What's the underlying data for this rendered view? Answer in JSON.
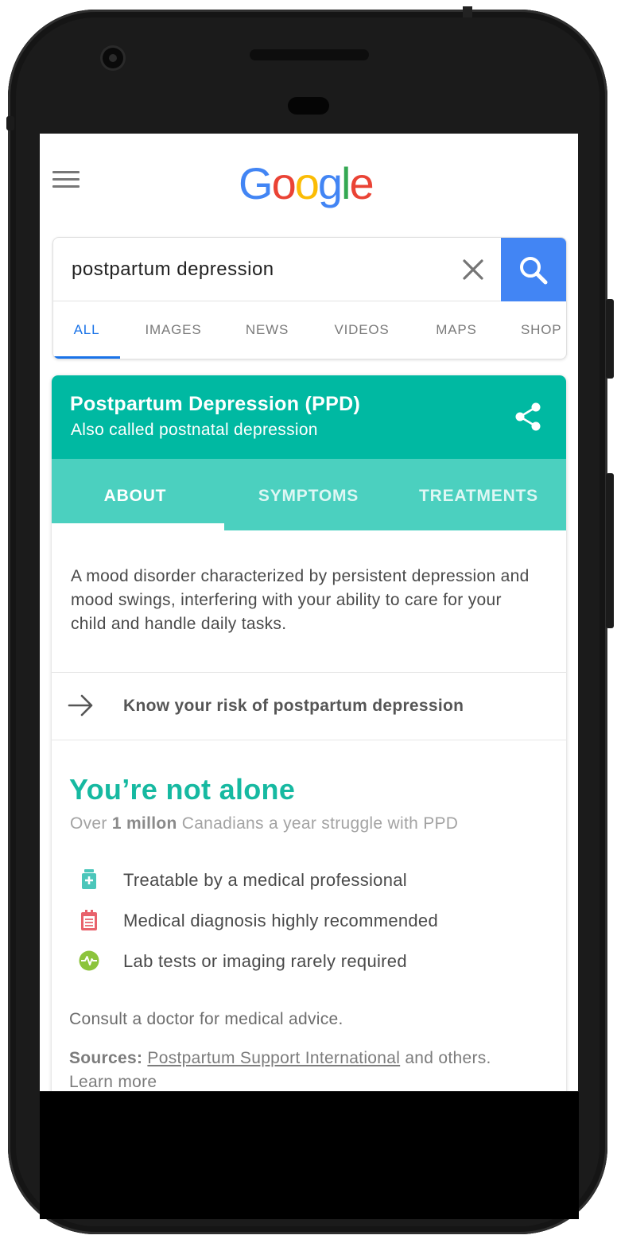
{
  "app": {
    "logo_text": "Google"
  },
  "search": {
    "query": "postpartum depression",
    "clear_icon": "close-icon",
    "search_icon": "search-icon"
  },
  "search_tabs": [
    {
      "label": "ALL",
      "active": true
    },
    {
      "label": "IMAGES",
      "active": false
    },
    {
      "label": "NEWS",
      "active": false
    },
    {
      "label": "VIDEOS",
      "active": false
    },
    {
      "label": "MAPS",
      "active": false
    },
    {
      "label": "SHOP",
      "active": false
    }
  ],
  "knowledge_card": {
    "title": "Postpartum Depression (PPD)",
    "subtitle": "Also called postnatal depression",
    "share_icon": "share-icon",
    "tabs": [
      {
        "label": "ABOUT",
        "active": true
      },
      {
        "label": "SYMPTOMS",
        "active": false
      },
      {
        "label": "TREATMENTS",
        "active": false
      }
    ],
    "description": "A mood disorder characterized by persistent depression and mood swings, interfering with your ability to care for your child and handle daily tasks.",
    "risk_link": "Know your risk of postpartum depression",
    "alone": {
      "title": "You’re not alone",
      "sub_prefix": "Over ",
      "sub_bold": "1 millon",
      "sub_suffix": " Canadians a year struggle with PPD"
    },
    "facts": [
      {
        "icon": "medicine-bottle-icon",
        "text": "Treatable by a medical professional"
      },
      {
        "icon": "clipboard-icon",
        "text": "Medical diagnosis highly recommended"
      },
      {
        "icon": "pulse-icon",
        "text": "Lab tests or imaging rarely required"
      }
    ],
    "consult": "Consult a doctor for medical advice.",
    "sources": {
      "label": "Sources:",
      "link": "Postpartum Support International",
      "suffix": " and others.",
      "learn_more": "Learn more"
    }
  },
  "colors": {
    "teal_header": "#00b9a2",
    "teal_tabs": "#4bd0bf",
    "google_blue": "#4285f4",
    "fact_icon_teal": "#4bc6ba",
    "fact_icon_red": "#e8626c",
    "fact_icon_green": "#8cc43c"
  }
}
